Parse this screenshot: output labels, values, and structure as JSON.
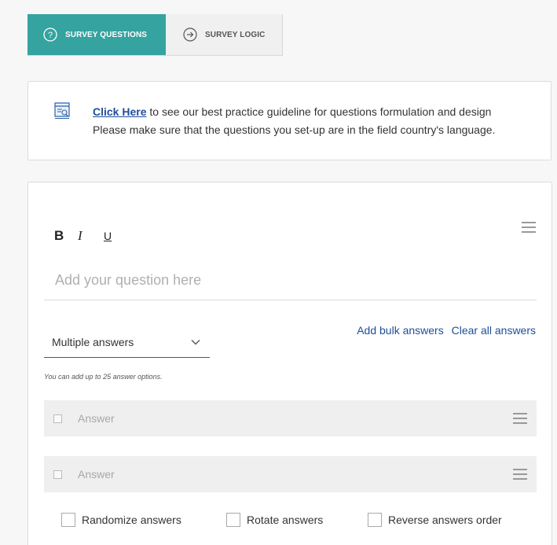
{
  "tabs": [
    {
      "label": "SURVEY QUESTIONS",
      "icon": "question-circle-icon",
      "active": true
    },
    {
      "label": "SURVEY LOGIC",
      "icon": "arrow-circle-right-icon",
      "active": false
    }
  ],
  "info": {
    "icon": "guideline-document-icon",
    "link_text": "Click Here",
    "line1_rest": " to see our best practice guideline for questions formulation and design",
    "line2": "Please make sure that the questions you set-up are in the field country's language."
  },
  "editor": {
    "bold": "B",
    "italic": "I",
    "underline": "U",
    "question_placeholder": "Add your question here",
    "answer_type": "Multiple answers",
    "add_bulk": "Add bulk answers",
    "clear_all": "Clear all answers",
    "helper": "You can add up to 25 answer options.",
    "answers": [
      {
        "placeholder": "Answer"
      },
      {
        "placeholder": "Answer"
      }
    ],
    "options": [
      {
        "label": "Randomize answers",
        "checked": false
      },
      {
        "label": "Rotate answers",
        "checked": false
      },
      {
        "label": "Reverse answers order",
        "checked": false
      }
    ]
  },
  "colors": {
    "accent": "#35a39f",
    "link": "#1f4e9a"
  }
}
